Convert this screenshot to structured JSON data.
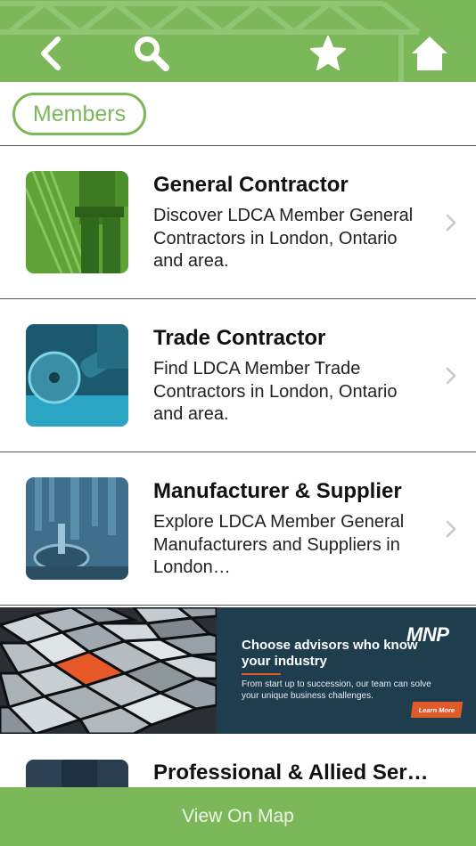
{
  "header": {
    "back_icon": "chevron-left-icon",
    "search_icon": "search-icon",
    "favorite_icon": "star-icon",
    "home_icon": "home-icon",
    "background_color": "#7cb85a"
  },
  "filter": {
    "members_label": "Members"
  },
  "list": {
    "items": [
      {
        "title": "General Contractor",
        "description": "Discover LDCA Member General Contractors in London, Ontario and area.",
        "thumb_color": "#5fa336"
      },
      {
        "title": "Trade Contractor",
        "description": "Find LDCA Member Trade Contractors in London, Ontario and area.",
        "thumb_color": "#2aa6c4"
      },
      {
        "title": "Manufacturer & Supplier",
        "description": "Explore LDCA Member General Manufacturers and Suppliers in London…",
        "thumb_color": "#3f6f8a"
      },
      {
        "title": "Professional & Allied Ser…",
        "thumb_color": "#1f3040"
      }
    ]
  },
  "ad": {
    "logo": "MNP",
    "headline": "Choose advisors who know your industry",
    "body": "From start up to succession, our team can solve your unique business challenges.",
    "button_label": "Learn More",
    "accent_color": "#e05a2a"
  },
  "footer": {
    "map_button_label": "View On Map"
  }
}
